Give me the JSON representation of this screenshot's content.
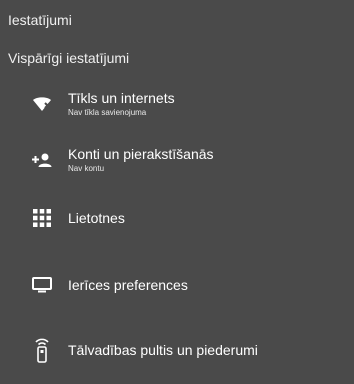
{
  "header": {
    "title": "Iestatījumi",
    "section": "Vispārīgi iestatījumi"
  },
  "items": [
    {
      "label": "Tīkls un internets",
      "subtitle": "Nav tīkla savienojuma",
      "icon": "wifi-off-icon"
    },
    {
      "label": "Konti un pierakstīšanās",
      "subtitle": "Nav kontu",
      "icon": "add-account-icon"
    },
    {
      "label": "Lietotnes",
      "icon": "apps-grid-icon"
    },
    {
      "label": "Ierīces preferences",
      "icon": "tv-icon"
    },
    {
      "label": "Tālvadības pultis un piederumi",
      "icon": "remote-icon"
    }
  ]
}
